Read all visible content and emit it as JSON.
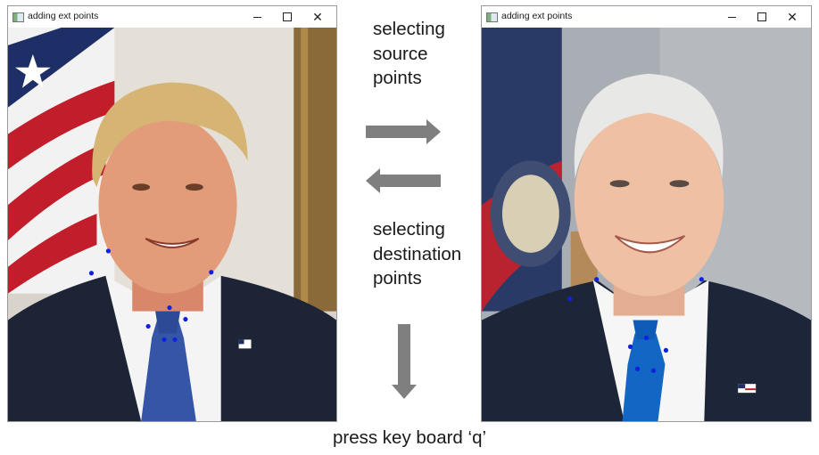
{
  "windows": {
    "left": {
      "title": "adding ext points"
    },
    "right": {
      "title": "adding ext points"
    }
  },
  "controls": {
    "minimize_icon": "minimize-icon",
    "maximize_icon": "maximize-icon",
    "close_glyph": "✕"
  },
  "labels": {
    "source": [
      "selecting",
      "source",
      "points"
    ],
    "destination": [
      "selecting",
      "destination",
      "points"
    ],
    "footer": "press key board ‘q’"
  },
  "colors": {
    "point": "#1020e0",
    "arrow": "#7f7f7f"
  }
}
